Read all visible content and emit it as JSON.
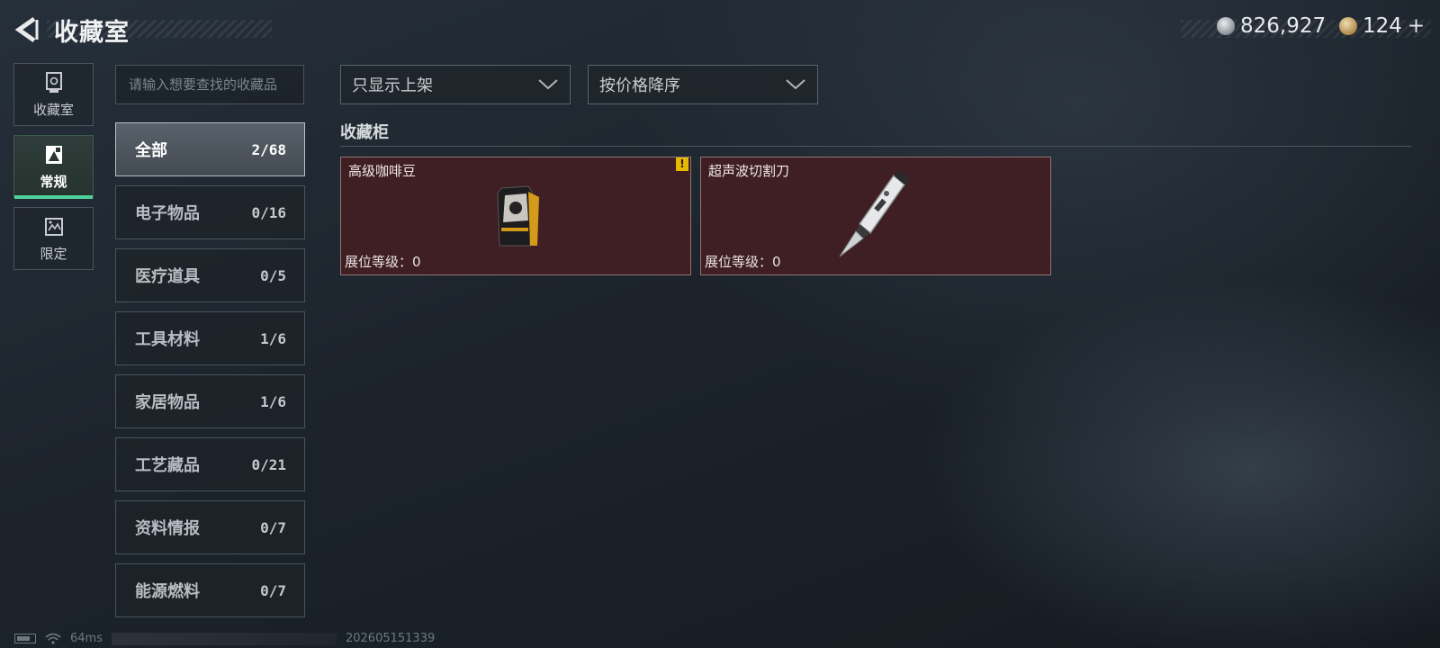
{
  "header": {
    "title": "收藏室",
    "currency_silver": "826,927",
    "currency_gold": "124",
    "add_symbol": "+"
  },
  "nav": [
    {
      "label": "收藏室",
      "icon": "trophy-icon"
    },
    {
      "label": "常规",
      "icon": "image-frame-icon",
      "active": true
    },
    {
      "label": "限定",
      "icon": "limited-frame-icon"
    }
  ],
  "search": {
    "placeholder": "请输入想要查找的收藏品"
  },
  "categories": [
    {
      "label": "全部",
      "count": "2/68",
      "active": true
    },
    {
      "label": "电子物品",
      "count": "0/16"
    },
    {
      "label": "医疗道具",
      "count": "0/5"
    },
    {
      "label": "工具材料",
      "count": "1/6"
    },
    {
      "label": "家居物品",
      "count": "1/6"
    },
    {
      "label": "工艺藏品",
      "count": "0/21"
    },
    {
      "label": "资料情报",
      "count": "0/7"
    },
    {
      "label": "能源燃料",
      "count": "0/7"
    }
  ],
  "filters": {
    "display": "只显示上架",
    "sort": "按价格降序"
  },
  "section": {
    "title": "收藏柜"
  },
  "items": [
    {
      "name": "高级咖啡豆",
      "level": "展位等级：0",
      "icon": "coffee-bag-icon",
      "badge": "!"
    },
    {
      "name": "超声波切割刀",
      "level": "展位等级：0",
      "icon": "ultrasonic-knife-icon"
    }
  ],
  "footer": {
    "ping": "64ms",
    "build": "202605151339"
  },
  "colors": {
    "accent": "#4fd19a",
    "card_bg": "#3f1f23",
    "badge": "#e6b800"
  }
}
